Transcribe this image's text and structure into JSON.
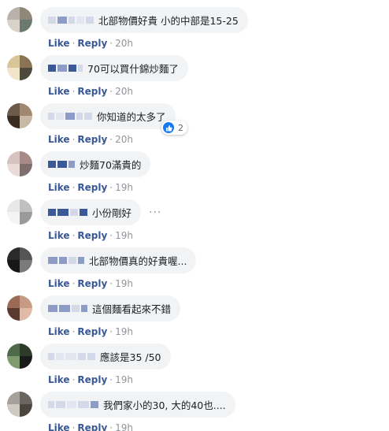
{
  "actions": {
    "like": "Like",
    "reply": "Reply",
    "separator": "·"
  },
  "comments": [
    {
      "text": "北部物價好貴 小的中部是15-25",
      "time": "20h",
      "avatar_colors": [
        "#b8b2a8",
        "#8f8778",
        "#d8d2c8",
        "#6b7a6e"
      ]
    },
    {
      "text": "70可以買什錦炒麵了",
      "time": "20h",
      "avatar_colors": [
        "#d8c59a",
        "#8a7455",
        "#f0e5c8",
        "#4c4a3a"
      ]
    },
    {
      "text": "你知道的太多了",
      "time": "20h",
      "reaction_count": "2",
      "avatar_colors": [
        "#6c5a48",
        "#a08870",
        "#3a2c22",
        "#c8b8a4"
      ]
    },
    {
      "text": "炒麵70滿貴的",
      "time": "19h",
      "avatar_colors": [
        "#d6c3c0",
        "#a88a88",
        "#eadbd7",
        "#7f6e6e"
      ]
    },
    {
      "text": "小份剛好",
      "time": "19h",
      "avatar_colors": [
        "#e8e8e8",
        "#c0c0c0",
        "#f4f4f4",
        "#9a9a9a"
      ]
    },
    {
      "text": "北部物價真的好貴喔...",
      "time": "19h",
      "avatar_colors": [
        "#2a2a2a",
        "#555555",
        "#171717",
        "#7a7a7a"
      ]
    },
    {
      "text": "這個麵看起來不錯",
      "time": "19h",
      "avatar_colors": [
        "#9a6a55",
        "#c79a84",
        "#5a3a2e",
        "#e1bba6"
      ]
    },
    {
      "text": "應該是35 /50",
      "time": "19h",
      "avatar_colors": [
        "#4f6a4a",
        "#2e3b2a",
        "#7f9a6f",
        "#1a1a1a"
      ]
    },
    {
      "text": "我們家小的30, 大的40也....",
      "time": "19h",
      "avatar_colors": [
        "#a5a09a",
        "#6a6560",
        "#cfc9c2",
        "#4a4540"
      ]
    }
  ]
}
